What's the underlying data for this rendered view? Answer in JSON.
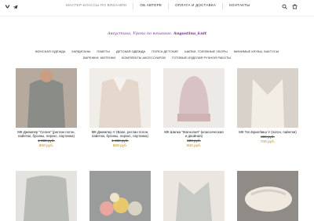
{
  "header": {
    "nav": [
      {
        "label": "Мастер-классы по вязанию",
        "active": true
      },
      {
        "label": "Об авторе",
        "active": false
      },
      {
        "label": "Оплата и доставка",
        "active": false
      },
      {
        "label": "Контакты",
        "active": false
      }
    ],
    "icons": [
      "vk-icon",
      "telegram-icon",
      "search-icon",
      "cart-icon"
    ]
  },
  "tagline": {
    "text": "Августина. Уроки по вязанию.",
    "handle": "Augustina_knit"
  },
  "categories": [
    "Женская одежда",
    "Кардиганы",
    "Пакеты",
    "Детская одежда",
    "Пояса детские",
    "Шапки, головные уборы",
    "Минимые клубы, бактусы",
    "Варежки, митенки",
    "Комплекты аксессуаров",
    "Готовые изделия ручной работы"
  ],
  "products": [
    {
      "name": "МК Джемпер \"Селин\" (реглан погон, пайетки, бусины, лерекс, паутинка)",
      "old_price": "1 000 руб.",
      "price": "800 руб.",
      "color": "#8e8f8a"
    },
    {
      "name": "МК Джемпер V (Base, реглан погон, пайетки, бусины, лерекс, паутинка)",
      "old_price": "1 000 руб.",
      "price": "800 руб.",
      "color": "#e9ddd3"
    },
    {
      "name": "МК Шапка \"Магнолия\" (классическая и двойная)",
      "old_price": "600 руб.",
      "price": "500 руб.",
      "color": "#dcc6c7"
    },
    {
      "name": "МК Топ Брил/виш V (погон, пайетки)",
      "old_price": "800 руб.",
      "price": "700 руб.",
      "color": "#efe8de"
    }
  ],
  "products_row2": [
    {
      "color": "#b9bbb6"
    },
    {
      "color": "#e8c86a"
    },
    {
      "color": "#c7c9c4"
    },
    {
      "color": "#d5d0c7"
    }
  ],
  "colors": {
    "accent_price": "#c9871a",
    "tagline": "#7a2ca0"
  }
}
